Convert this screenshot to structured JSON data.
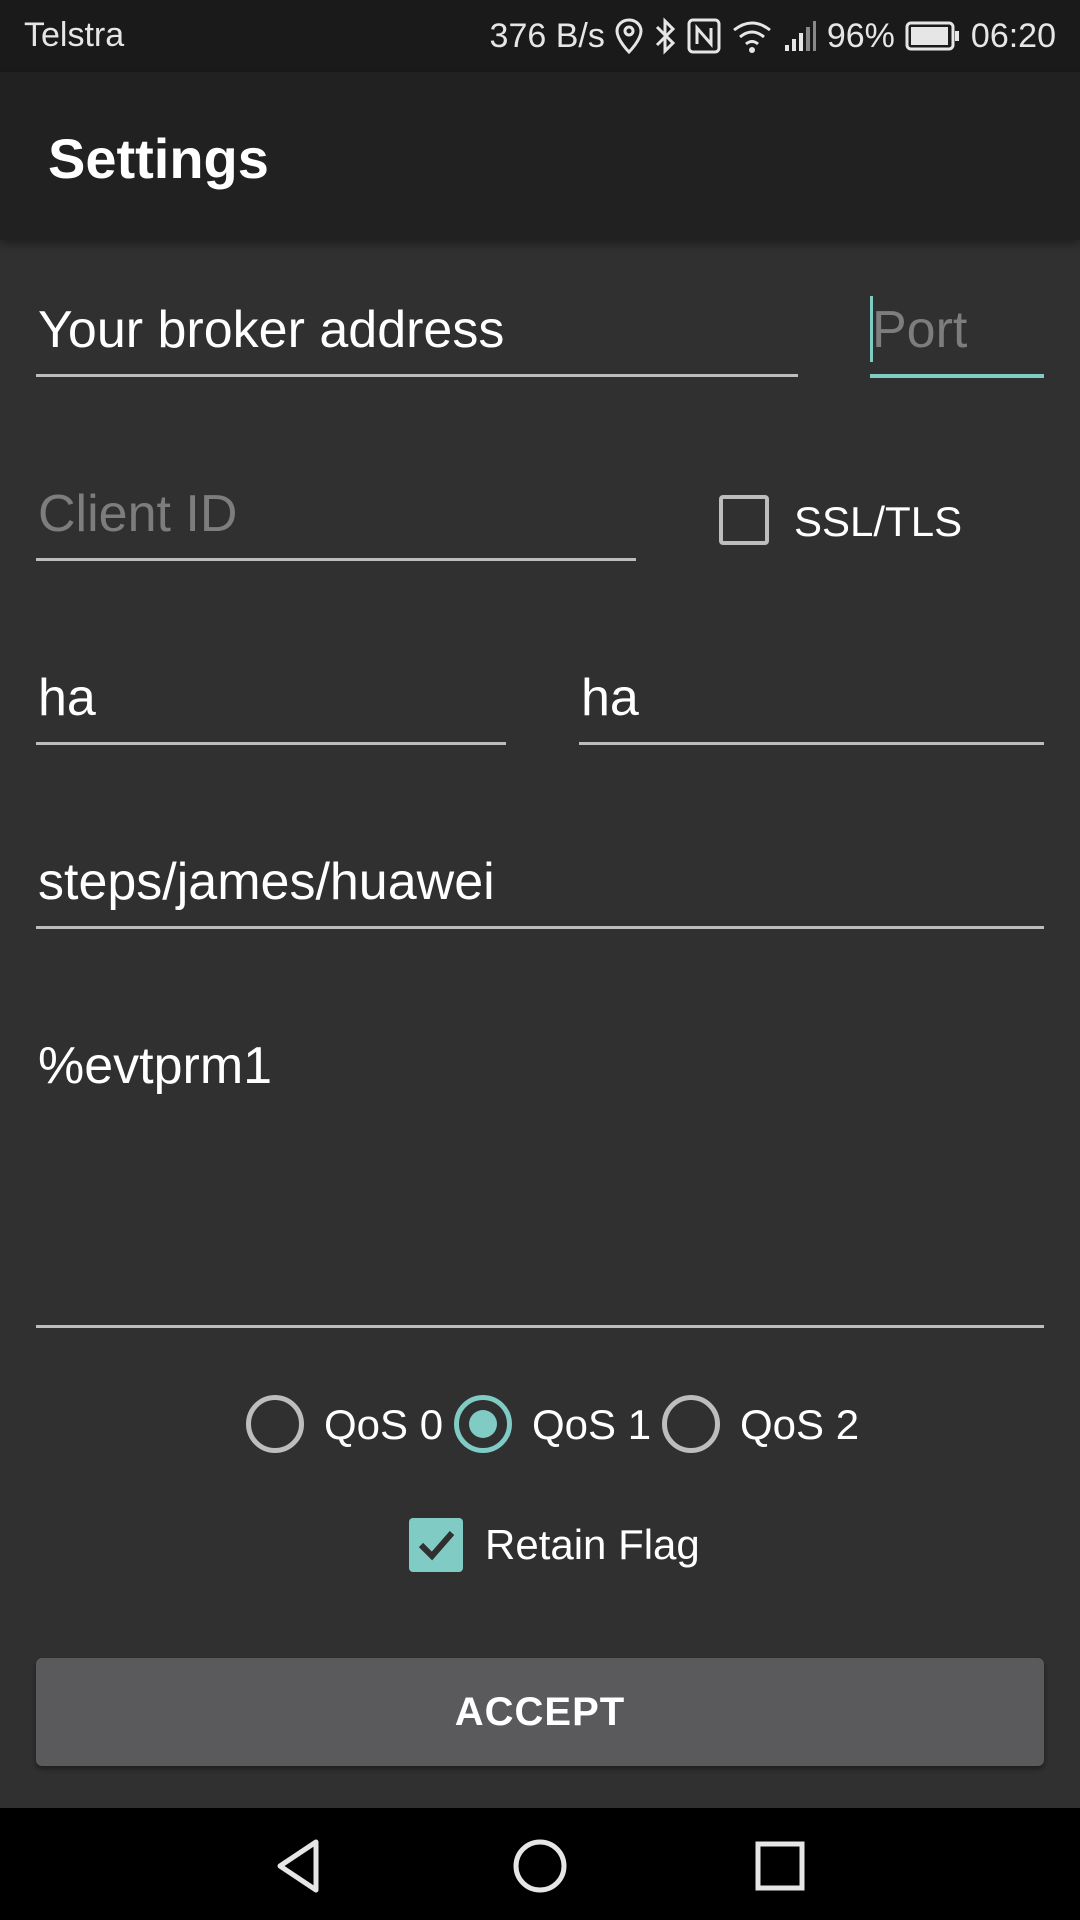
{
  "status_bar": {
    "carrier": "Telstra",
    "speed": "376 B/s",
    "battery": "96%",
    "time": "06:20"
  },
  "app_bar": {
    "title": "Settings"
  },
  "form": {
    "broker": {
      "value": "",
      "placeholder": "Your broker address",
      "placeholder_color": "#ffffff"
    },
    "port": {
      "value": "",
      "placeholder": "Port"
    },
    "client_id": {
      "value": "",
      "placeholder": "Client ID"
    },
    "ssl": {
      "label": "SSL/TLS",
      "checked": false
    },
    "username": {
      "value": "ha"
    },
    "password": {
      "value": "ha"
    },
    "topic": {
      "value": "steps/james/huawei"
    },
    "message": {
      "value": "%evtprm1"
    },
    "qos": {
      "options": [
        "QoS 0",
        "QoS 1",
        "QoS 2"
      ],
      "selected": "QoS 1"
    },
    "retain": {
      "label": "Retain Flag",
      "checked": true
    },
    "accept_label": "ACCEPT"
  },
  "colors": {
    "accent": "#80cbc4",
    "background": "#303030",
    "app_bar": "#212121",
    "button": "#5a5a5c"
  }
}
